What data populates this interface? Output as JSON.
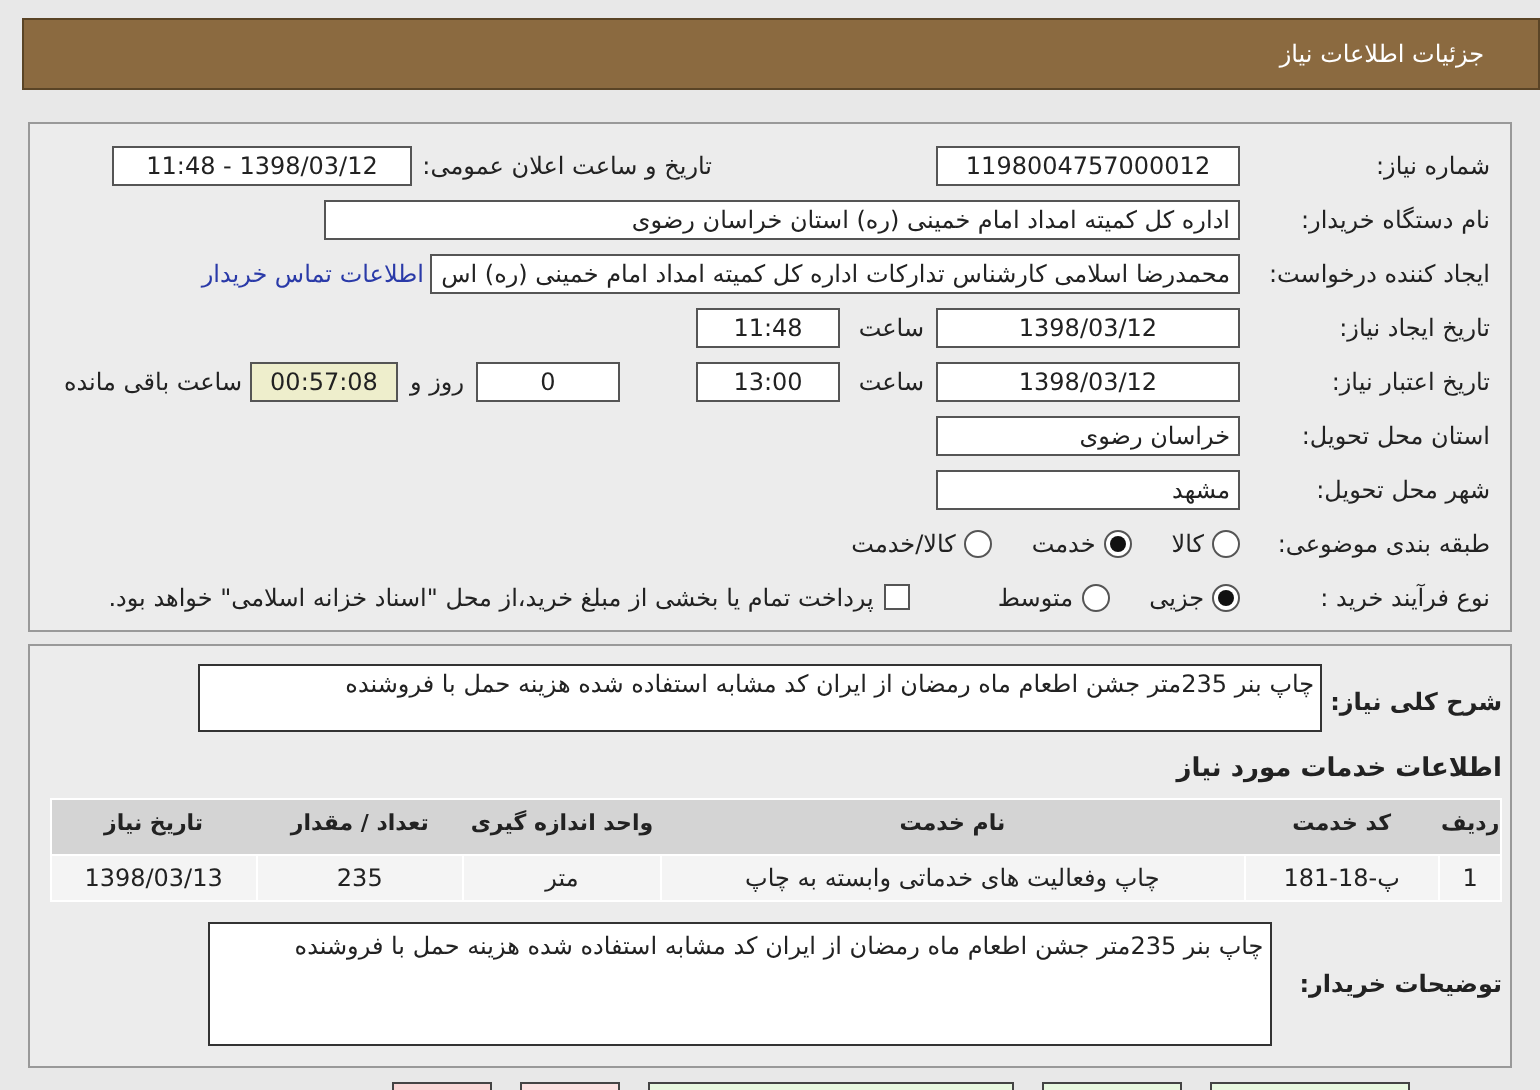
{
  "header": {
    "title": "جزئیات اطلاعات نیاز"
  },
  "details": {
    "need_number": {
      "label": "شماره نیاز:",
      "value": "1198004757000012"
    },
    "announce": {
      "label": "تاریخ و ساعت اعلان عمومی:",
      "value": "1398/03/12 - 11:48"
    },
    "buyer_org": {
      "label": "نام دستگاه خریدار:",
      "value": "اداره کل کمیته امداد امام خمینی (ره) استان خراسان رضوی"
    },
    "requester": {
      "label": "ایجاد کننده درخواست:",
      "value": "محمدرضا اسلامی کارشناس تدارکات اداره کل کمیته امداد امام خمینی (ره) اس",
      "link": "اطلاعات تماس خریدار"
    },
    "created": {
      "label": "تاریخ ایجاد نیاز:",
      "date": "1398/03/12",
      "time_label": "ساعت",
      "time": "11:48"
    },
    "validity": {
      "label": "تاریخ اعتبار نیاز:",
      "date": "1398/03/12",
      "time_label": "ساعت",
      "time": "13:00",
      "days": "0",
      "days_label": "روز و",
      "remaining": "00:57:08",
      "remaining_label": "ساعت باقی مانده"
    },
    "province": {
      "label": "استان محل تحویل:",
      "value": "خراسان رضوی"
    },
    "city": {
      "label": "شهر محل تحویل:",
      "value": "مشهد"
    },
    "category": {
      "label": "طبقه بندی موضوعی:",
      "options": [
        {
          "label": "کالا",
          "selected": false
        },
        {
          "label": "خدمت",
          "selected": true
        },
        {
          "label": "کالا/خدمت",
          "selected": false
        }
      ]
    },
    "purchase_type": {
      "label": "نوع فرآیند خرید :",
      "options": [
        {
          "label": "جزیی",
          "selected": true
        },
        {
          "label": "متوسط",
          "selected": false
        }
      ],
      "payment": {
        "label": "پرداخت تمام یا بخشی از مبلغ خرید،از محل \"اسناد خزانه اسلامی\" خواهد بود.",
        "checked": false
      }
    }
  },
  "summary": {
    "label": "شرح کلی نیاز:",
    "value": "چاپ بنر 235متر جشن اطعام ماه رمضان  از ایران کد مشابه استفاده شده هزینه حمل با فروشنده"
  },
  "services": {
    "title": "اطلاعات خدمات مورد نیاز",
    "columns": [
      "ردیف",
      "کد خدمت",
      "نام خدمت",
      "واحد اندازه گیری",
      "تعداد / مقدار",
      "تاریخ نیاز"
    ],
    "rows": [
      [
        "1",
        "پ-18-181",
        "چاپ وفعالیت های خدماتی وابسته به چاپ",
        "متر",
        "235",
        "1398/03/13"
      ]
    ]
  },
  "buyer_notes": {
    "label": "توضیحات خریدار:",
    "value": "چاپ بنر 235متر جشن اطعام ماه رمضان  از ایران کد مشابه استفاده شده هزینه حمل با فروشنده"
  },
  "bottom_buttons": [
    {
      "color": "#e8f8e0"
    },
    {
      "color": "#e8f8e0"
    },
    {
      "color": "#e8f8e0"
    },
    {
      "color": "#fbe0e0"
    },
    {
      "color": "#f9d6d6"
    }
  ]
}
